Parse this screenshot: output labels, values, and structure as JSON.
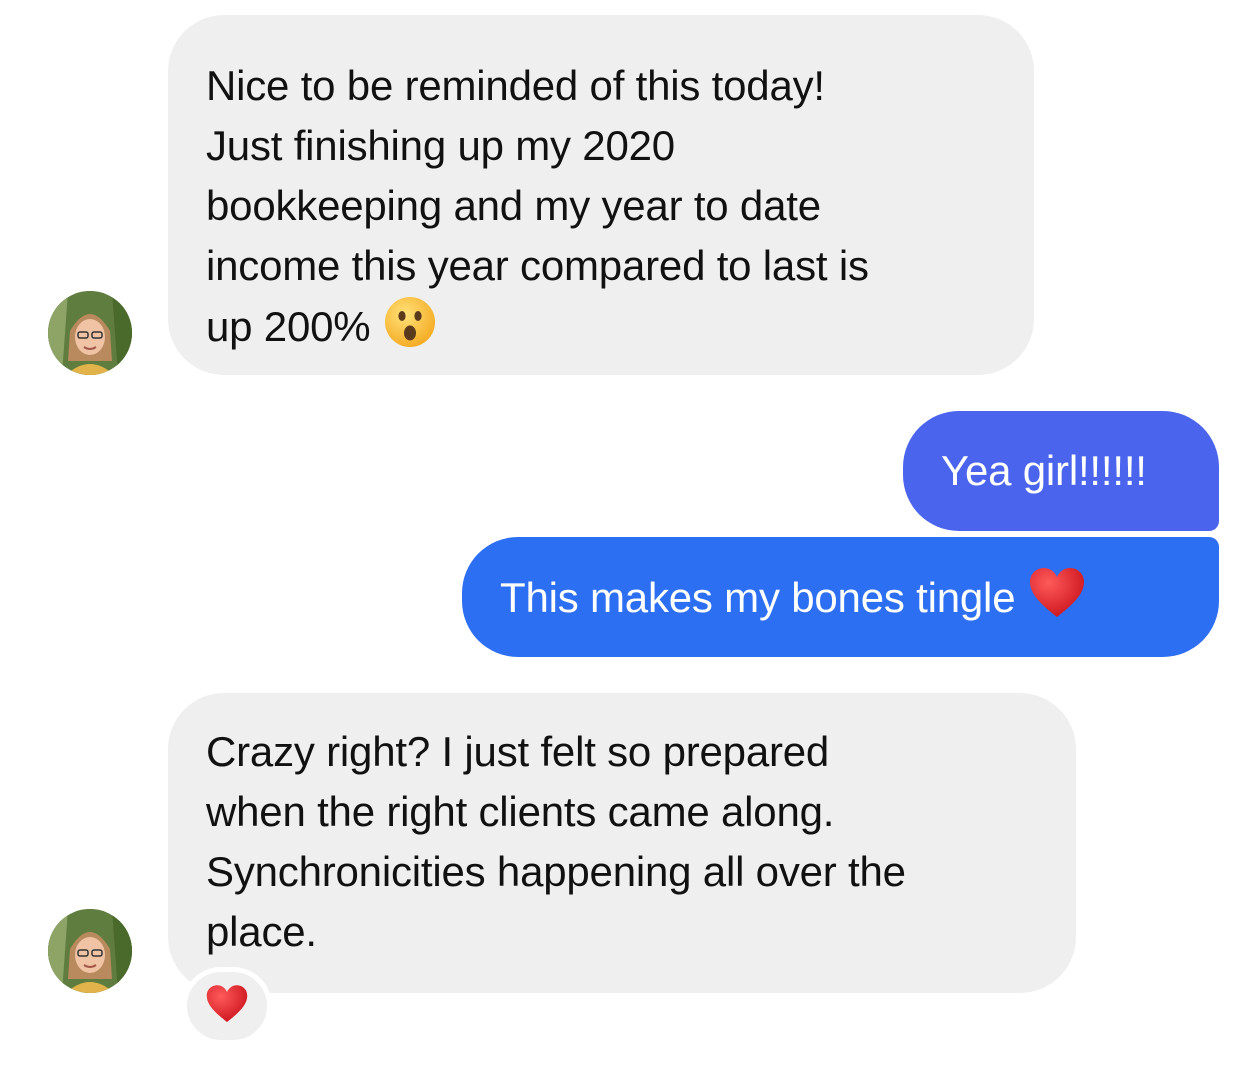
{
  "messages": [
    {
      "direction": "incoming",
      "lines": [
        "Nice to be reminded of this today!",
        "Just finishing up my 2020",
        "bookkeeping and my year to date",
        "income this year compared to last is",
        "up 200%"
      ],
      "emoji": "astonished-face"
    },
    {
      "direction": "outgoing",
      "text": "Yea girl!!!!!!"
    },
    {
      "direction": "outgoing",
      "text": "This makes my bones tingle",
      "emoji": "red-heart"
    },
    {
      "direction": "incoming",
      "lines": [
        "Crazy right? I just felt so prepared",
        "when the right clients came along.",
        "Synchronicities happening all over the",
        "place."
      ],
      "reaction": "red-heart"
    }
  ],
  "colors": {
    "incoming_bubble": "#efefef",
    "outgoing_bubble_top": "#4a64ee",
    "outgoing_bubble_bottom": "#2d6ff2",
    "incoming_text": "#111111",
    "outgoing_text": "#ffffff"
  }
}
